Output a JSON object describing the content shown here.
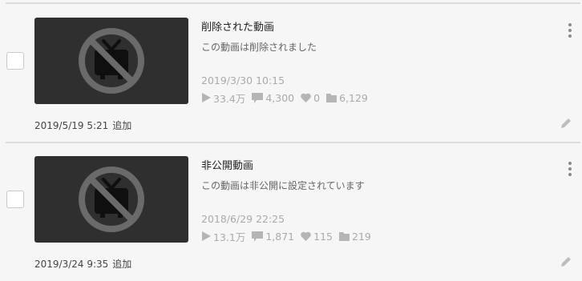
{
  "items": [
    {
      "title": "削除された動画",
      "description": "この動画は削除されました",
      "post_date": "2019/3/30 10:15",
      "views": "33.4万",
      "comments": "4,300",
      "likes": "0",
      "mylists": "6,129",
      "added_date": "2019/5/19 5:21",
      "added_label": "追加"
    },
    {
      "title": "非公開動画",
      "description": "この動画は非公開に設定されています",
      "post_date": "2018/6/29 22:25",
      "views": "13.1万",
      "comments": "1,871",
      "likes": "115",
      "mylists": "219",
      "added_date": "2019/3/24 9:35",
      "added_label": "追加"
    }
  ],
  "colors": {
    "background": "#f6f6f6",
    "thumbnail": "#2f2f2f",
    "muted": "#aaaaaa",
    "icon": "#b5b5b5"
  },
  "icons": {
    "thumbnail": "prohibited-tv-icon",
    "views": "play-icon",
    "comments": "comment-icon",
    "likes": "heart-icon",
    "mylists": "folder-icon",
    "menu": "more-vertical-icon",
    "edit": "pencil-icon"
  }
}
